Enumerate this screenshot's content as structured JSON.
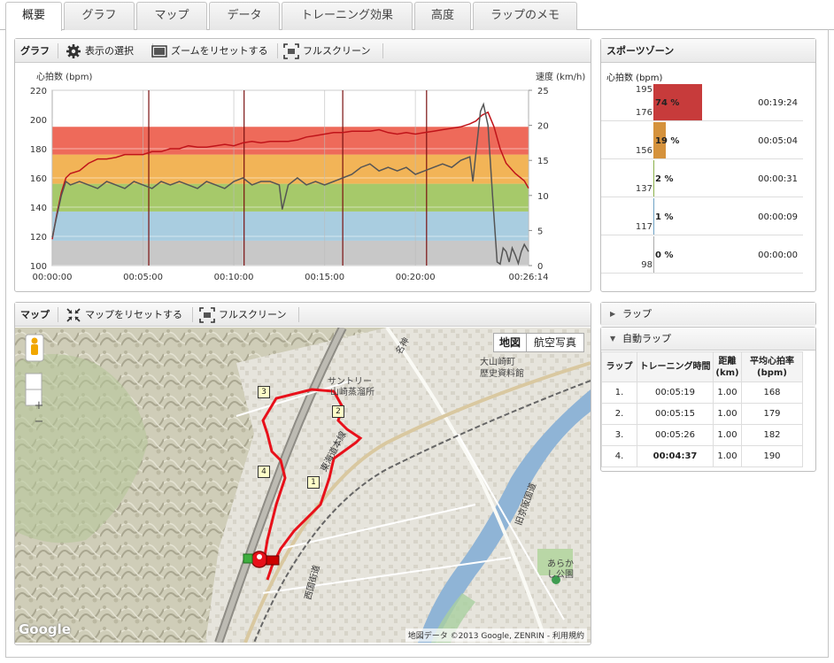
{
  "tabs": [
    "概要",
    "グラフ",
    "マップ",
    "データ",
    "トレーニング効果",
    "高度",
    "ラップのメモ"
  ],
  "graph_panel": {
    "title": "グラフ",
    "select_label": "表示の選択",
    "zoom_reset_label": "ズームをリセットする",
    "fullscreen_label": "フルスクリーン"
  },
  "chart_data": {
    "type": "line",
    "ylabel_left": "心拍数 (bpm)",
    "ylabel_right": "速度 (km/h)",
    "ylim_left": [
      100,
      220
    ],
    "yticks_left": [
      100,
      120,
      140,
      160,
      180,
      200,
      220
    ],
    "ylim_right": [
      0,
      25
    ],
    "yticks_right": [
      0,
      5,
      10,
      15,
      20,
      25
    ],
    "xlim_seconds": [
      0,
      1574
    ],
    "xtick_labels": [
      "00:00:00",
      "00:05:00",
      "00:10:00",
      "00:15:00",
      "00:20:00",
      "00:26:14"
    ],
    "xtick_seconds": [
      0,
      300,
      600,
      900,
      1200,
      1574
    ],
    "lap_marker_seconds": [
      319,
      634,
      960,
      1237
    ],
    "zone_bands": [
      {
        "from": 100,
        "to": 117,
        "color": "#c8c8c8"
      },
      {
        "from": 117,
        "to": 137,
        "color": "#a9cde0"
      },
      {
        "from": 137,
        "to": 156,
        "color": "#a6c96a"
      },
      {
        "from": 156,
        "to": 176,
        "color": "#f2b457"
      },
      {
        "from": 176,
        "to": 195,
        "color": "#ee6a5a"
      }
    ],
    "series": [
      {
        "name": "心拍数",
        "axis": "left",
        "color": "#c0141a",
        "x": [
          0,
          15,
          30,
          45,
          60,
          90,
          120,
          150,
          180,
          210,
          240,
          270,
          300,
          330,
          360,
          390,
          420,
          450,
          480,
          510,
          540,
          570,
          600,
          630,
          660,
          690,
          720,
          750,
          780,
          810,
          840,
          870,
          900,
          930,
          960,
          990,
          1020,
          1050,
          1080,
          1110,
          1140,
          1170,
          1200,
          1230,
          1260,
          1290,
          1320,
          1350,
          1380,
          1400,
          1420,
          1440,
          1460,
          1480,
          1500,
          1530,
          1560,
          1574
        ],
        "y": [
          118,
          135,
          150,
          160,
          163,
          165,
          170,
          173,
          173,
          174,
          176,
          176,
          176,
          178,
          178,
          180,
          180,
          182,
          181,
          181,
          182,
          183,
          182,
          184,
          185,
          184,
          185,
          185,
          185,
          186,
          188,
          189,
          190,
          191,
          191,
          192,
          192,
          192,
          193,
          191,
          190,
          191,
          190,
          191,
          192,
          193,
          194,
          195,
          197,
          199,
          203,
          205,
          195,
          180,
          170,
          163,
          158,
          153
        ]
      },
      {
        "name": "速度",
        "axis": "right",
        "color": "#555555",
        "x": [
          0,
          15,
          30,
          45,
          60,
          90,
          120,
          150,
          180,
          210,
          240,
          270,
          300,
          330,
          360,
          390,
          420,
          450,
          480,
          510,
          540,
          570,
          600,
          630,
          660,
          690,
          720,
          750,
          760,
          780,
          810,
          840,
          870,
          900,
          930,
          960,
          990,
          1020,
          1050,
          1080,
          1110,
          1140,
          1170,
          1200,
          1230,
          1260,
          1290,
          1320,
          1350,
          1380,
          1390,
          1400,
          1415,
          1425,
          1440,
          1455,
          1470,
          1480,
          1490,
          1500,
          1510,
          1520,
          1530,
          1540,
          1550,
          1560,
          1574
        ],
        "y": [
          4,
          7,
          10,
          12,
          11.5,
          12,
          11.5,
          11,
          12,
          11.5,
          11,
          12,
          11.5,
          11,
          12,
          11.5,
          12,
          11.5,
          11,
          12,
          11.5,
          11,
          12,
          12.5,
          11.5,
          12,
          12,
          11.5,
          8,
          11.5,
          12.5,
          11.5,
          12,
          11.5,
          12,
          12.5,
          13,
          14,
          14.5,
          13.5,
          14,
          13.5,
          14,
          13,
          13.5,
          14,
          14.5,
          14,
          15,
          15.5,
          12,
          16,
          22,
          23,
          20,
          10,
          0.5,
          0.2,
          2.5,
          2,
          0.5,
          2.5,
          1.5,
          0.3,
          2,
          3,
          2
        ]
      }
    ]
  },
  "zones": {
    "title": "スポーツゾーン",
    "unit_label": "心拍数 (bpm)",
    "rows": [
      {
        "hi": "195",
        "lo": "176",
        "pct": "74 %",
        "pct_value": 74,
        "time": "00:19:24",
        "color": "#c73b3b"
      },
      {
        "hi": "",
        "lo": "156",
        "pct": "19 %",
        "pct_value": 19,
        "time": "00:05:04",
        "color": "#d5923c"
      },
      {
        "hi": "",
        "lo": "137",
        "pct": "2 %",
        "pct_value": 2,
        "time": "00:00:31",
        "color": "#8ab04a"
      },
      {
        "hi": "",
        "lo": "117",
        "pct": "1 %",
        "pct_value": 1,
        "time": "00:00:09",
        "color": "#6fa2c4"
      },
      {
        "hi": "",
        "lo": "98",
        "pct": "0 %",
        "pct_value": 0,
        "time": "00:00:00",
        "color": "#aaaaaa"
      }
    ]
  },
  "laps_header": "ラップ",
  "auto_laps": {
    "title": "自動ラップ",
    "columns": [
      "ラップ",
      "トレーニング時間",
      "距離\n(km)",
      "平均心拍率\n(bpm)"
    ],
    "rows": [
      [
        "1.",
        "00:05:19",
        "1.00",
        "168"
      ],
      [
        "2.",
        "00:05:15",
        "1.00",
        "179"
      ],
      [
        "3.",
        "00:05:26",
        "1.00",
        "182"
      ],
      [
        "4.",
        "00:04:37",
        "1.00",
        "190"
      ]
    ]
  },
  "map_panel": {
    "title": "マップ",
    "reset_label": "マップをリセットする",
    "fullscreen_label": "フルスクリーン",
    "type_map": "地図",
    "type_satellite": "航空写真",
    "zoom_in": "+",
    "zoom_out": "−",
    "logo": "Google",
    "attribution": "地図データ ©2013 Google, ZENRIN - 利用規約",
    "labels": [
      "サントリー",
      "山崎蒸溜所",
      "大山崎町",
      "歴史資料館",
      "東海道本線",
      "西国街道",
      "旧京阪国道",
      "あらか",
      "し公園",
      "名神"
    ],
    "lap_markers": [
      "1",
      "2",
      "3",
      "4"
    ]
  }
}
